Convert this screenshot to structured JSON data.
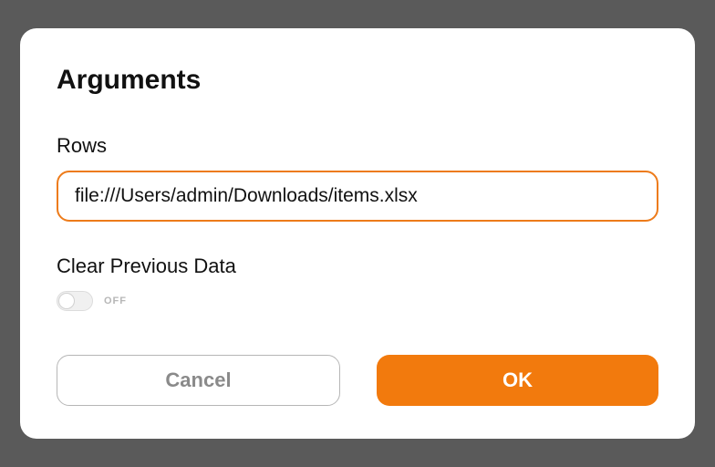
{
  "modal": {
    "title": "Arguments",
    "rows_label": "Rows",
    "rows_value": "file:///Users/admin/Downloads/items.xlsx",
    "clear_label": "Clear Previous Data",
    "toggle_state": "OFF",
    "cancel_label": "Cancel",
    "ok_label": "OK"
  },
  "colors": {
    "accent": "#f27a0d",
    "input_border": "#ed7b1a"
  }
}
